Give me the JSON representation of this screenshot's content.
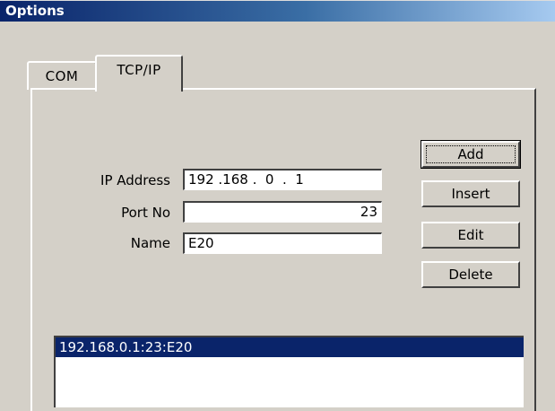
{
  "window": {
    "title": "Options"
  },
  "tabs": [
    {
      "label": "COM",
      "active": false
    },
    {
      "label": "TCP/IP",
      "active": true
    }
  ],
  "form": {
    "ip_label": "IP Address",
    "ip_value": "192 .168 .  0  .  1",
    "port_label": "Port No",
    "port_value": "23",
    "name_label": "Name",
    "name_value": "E20"
  },
  "buttons": {
    "add": "Add",
    "insert": "Insert",
    "edit": "Edit",
    "delete": "Delete"
  },
  "list": {
    "items": [
      "192.168.0.1:23:E20"
    ],
    "selected_index": 0
  },
  "colors": {
    "titlebar": "#0a246a",
    "selection": "#0a246a",
    "face": "#d4d0c8"
  }
}
